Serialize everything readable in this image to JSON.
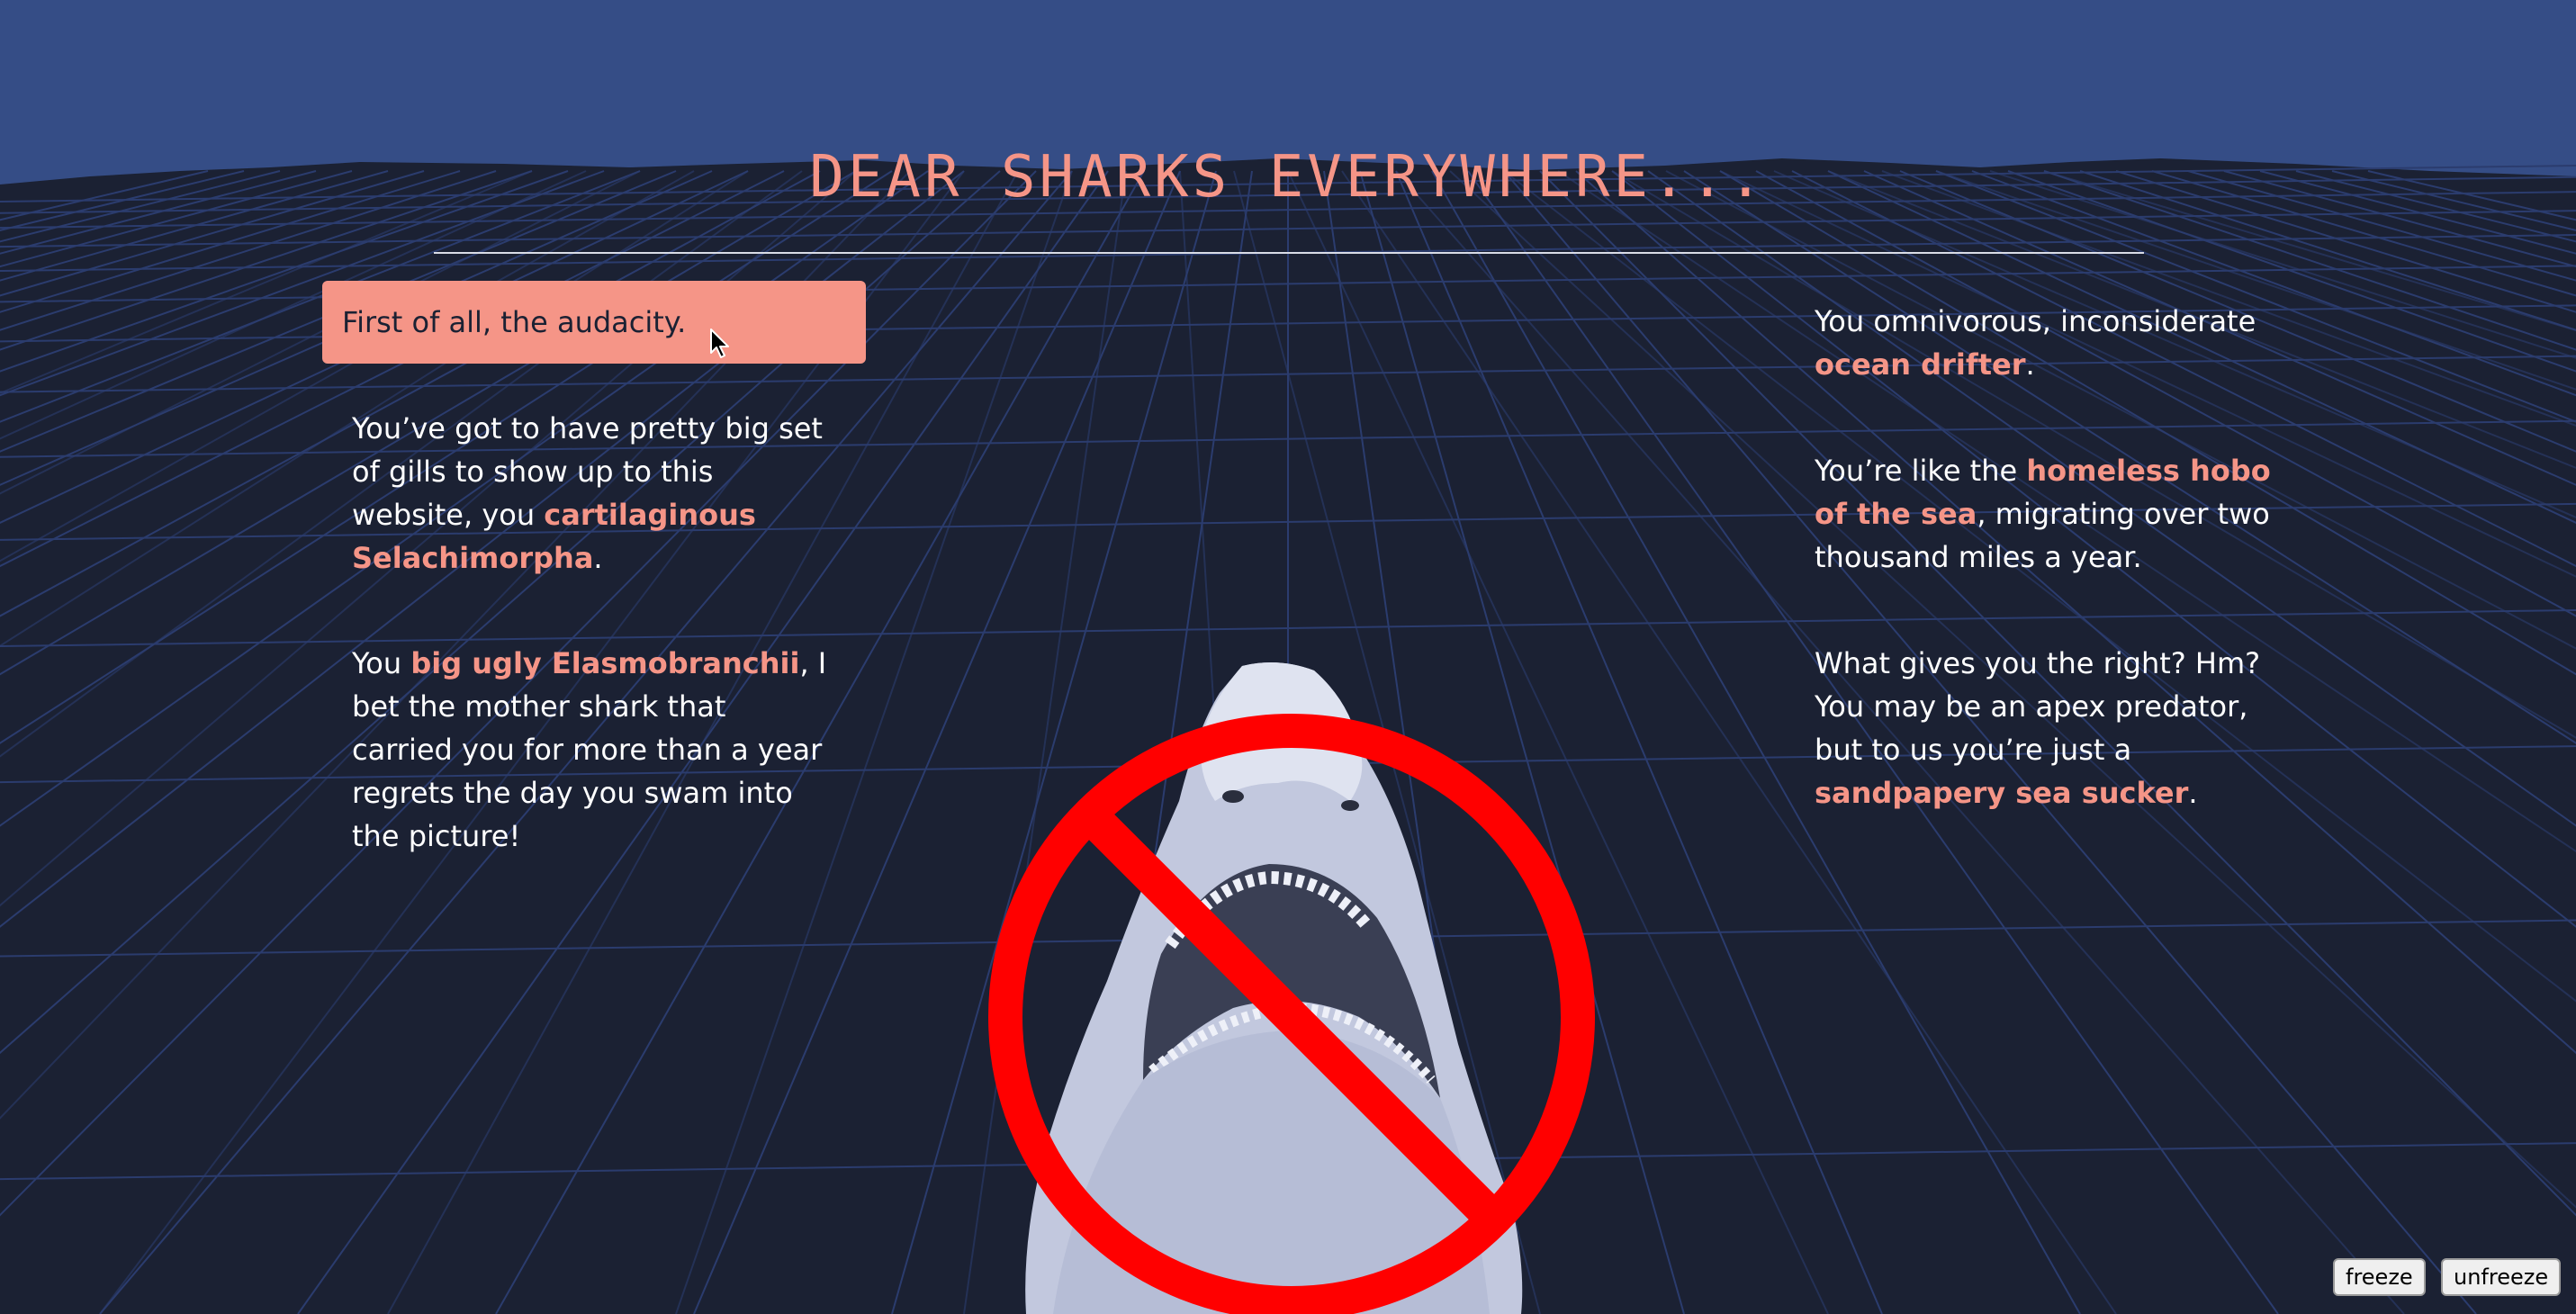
{
  "title": "DEAR SHARKS EVERYWHERE...",
  "highlight_text": "First of all, the audacity.",
  "left_column": {
    "para1": {
      "prefix": "You’ve got to have pretty big set of gills to show up to this website, you ",
      "emphasis": "cartilaginous Selachimorpha",
      "suffix": "."
    },
    "para2": {
      "prefix": "You ",
      "emphasis": "big ugly Elasmobranchii",
      "suffix": ", I bet the mother shark that carried you for more than a year regrets the day you swam into the picture!"
    }
  },
  "right_column": {
    "para1": {
      "prefix": "You omnivorous, inconsiderate ",
      "emphasis": "ocean drifter",
      "suffix": "."
    },
    "para2": {
      "prefix": "You’re like the ",
      "emphasis": "homeless hobo of the sea",
      "suffix": ", migrating over two thousand miles a year."
    },
    "para3": {
      "prefix": "What gives you the right? Hm? You may be an apex predator, but to us you’re just a ",
      "emphasis": "sandpapery sea sucker",
      "suffix": "."
    }
  },
  "controls": {
    "freeze_label": "freeze",
    "unfreeze_label": "unfreeze"
  },
  "colors": {
    "sky": "#354d86",
    "ground": "#1b2133",
    "grid": "#2b3c6e",
    "accent": "#f59587",
    "prohibit": "#ff0000"
  },
  "icons": {
    "cursor": "arrow-cursor-icon",
    "prohibition": "no-sign-icon"
  }
}
